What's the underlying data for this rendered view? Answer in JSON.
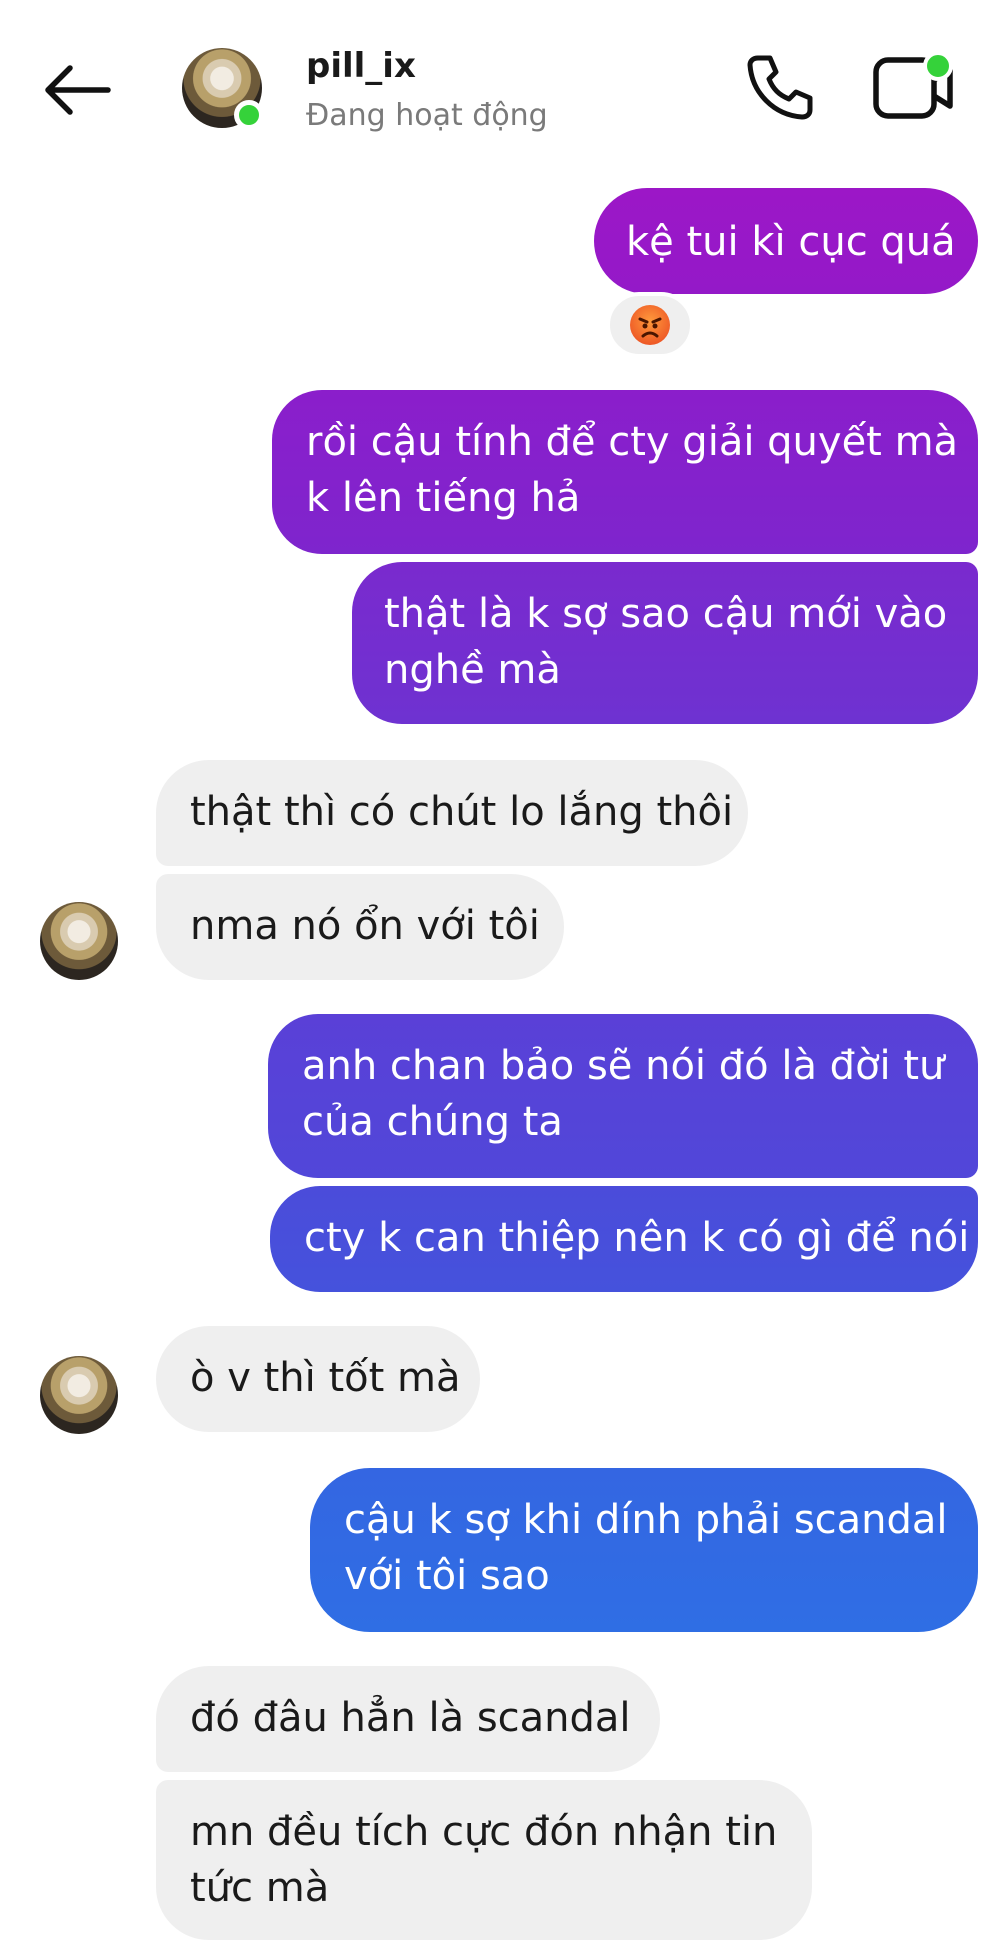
{
  "header": {
    "username": "pill_ix",
    "status": "Đang hoạt động",
    "back_icon": "arrow-left-icon",
    "call_icon": "phone-icon",
    "video_icon": "video-camera-icon"
  },
  "reaction_emoji": "😡",
  "messages": [
    {
      "side": "out",
      "lines": [
        "kệ tui kì cục quá"
      ]
    },
    {
      "side": "out",
      "lines": [
        "rồi cậu tính để cty giải quyết mà",
        "k lên tiếng hả"
      ]
    },
    {
      "side": "out",
      "lines": [
        "thật là k sợ sao cậu mới vào",
        "nghề mà"
      ]
    },
    {
      "side": "in",
      "lines": [
        "thật thì có chút lo lắng thôi"
      ]
    },
    {
      "side": "in",
      "lines": [
        "nma nó ổn với tôi"
      ]
    },
    {
      "side": "out",
      "lines": [
        "anh chan bảo sẽ nói đó là đời tư",
        "của chúng ta"
      ]
    },
    {
      "side": "out",
      "lines": [
        "cty k can thiệp nên k có gì để nói"
      ]
    },
    {
      "side": "in",
      "lines": [
        "ò v thì tốt mà"
      ]
    },
    {
      "side": "out",
      "lines": [
        "cậu k sợ khi dính phải scandal",
        "với tôi sao"
      ]
    },
    {
      "side": "in",
      "lines": [
        "đó đâu hẳn là scandal"
      ]
    },
    {
      "side": "in",
      "lines": [
        "mn đều tích cực đón nhận tin",
        "tức mà"
      ]
    }
  ],
  "colors": {
    "outgoing_gradient": [
      "#9b18c8",
      "#7a2cd0",
      "#5a42d8",
      "#3d5fe0",
      "#2f6ee4"
    ],
    "incoming_bg": "#efefef",
    "online": "#35d23a"
  }
}
